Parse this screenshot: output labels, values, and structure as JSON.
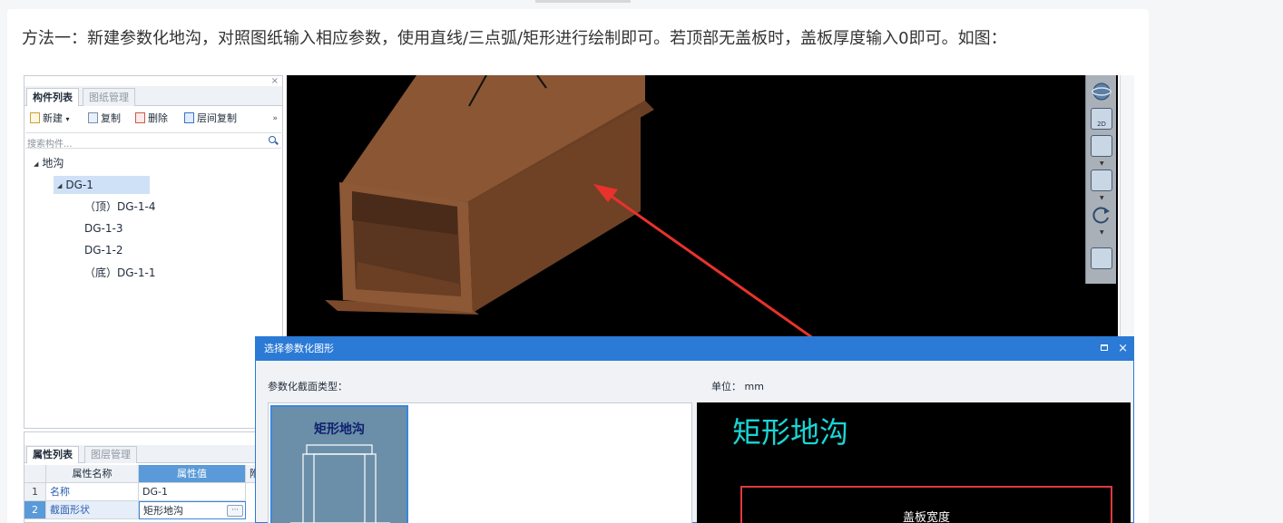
{
  "intro_text": "方法一：新建参数化地沟，对照图纸输入相应参数，使用直线/三点弧/矩形进行绘制即可。若顶部无盖板时，盖板厚度输入0即可。如图：",
  "component_panel": {
    "close_glyph": "×",
    "tabs": [
      "构件列表",
      "图纸管理"
    ],
    "toolbar": {
      "new_label": "新建",
      "new_caret": "▾",
      "copy_label": "复制",
      "delete_label": "删除",
      "layer_copy_label": "层间复制",
      "more_glyph": "»"
    },
    "search_placeholder": "搜索构件...",
    "tree": {
      "root": "地沟",
      "child": "DG-1",
      "leaves": [
        "（顶）DG-1-4",
        "DG-1-3",
        "DG-1-2",
        "（底）DG-1-1"
      ]
    },
    "tree_glyph": "◢"
  },
  "properties_panel": {
    "tabs": [
      "属性列表",
      "图层管理"
    ],
    "columns": [
      "属性名称",
      "属性值",
      "附"
    ],
    "rows": [
      {
        "num": "1",
        "name": "名称",
        "value": "DG-1"
      },
      {
        "num": "2",
        "name": "截面形状",
        "value": "矩形地沟"
      }
    ],
    "ellipsis": "···"
  },
  "viewport_tools": {
    "view_2d_label": "2D"
  },
  "dialog": {
    "title": "选择参数化图形",
    "close_glyph": "×",
    "section_type_label": "参数化截面类型：",
    "unit_label": "单位： mm",
    "selected_type": "矩形地沟",
    "preview_title": "矩形地沟",
    "preview_dim_label": "盖板宽度"
  },
  "colors": {
    "dialog_accent": "#2b7ad6",
    "preview_title": "#19d6d6",
    "annotation_arrow": "#e8322c",
    "trench_brown": "#7b4a2c"
  }
}
